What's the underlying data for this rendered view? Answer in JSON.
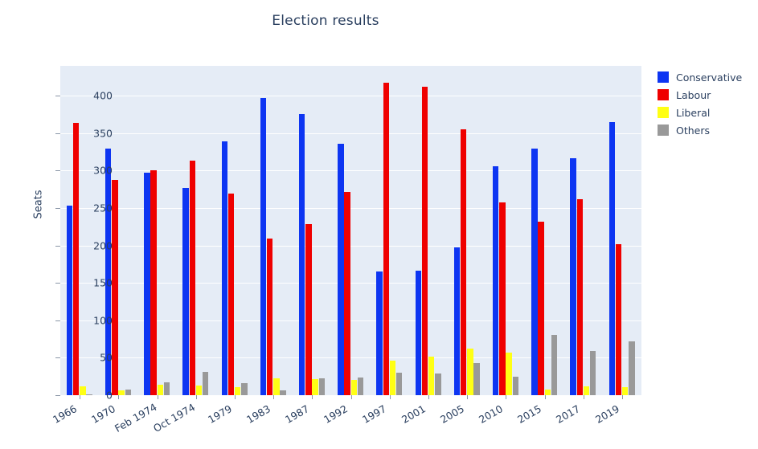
{
  "chart_data": {
    "type": "bar",
    "title": "Election results",
    "xlabel": "",
    "ylabel": "Seats",
    "ylim": [
      0,
      440
    ],
    "yticks": [
      0,
      50,
      100,
      150,
      200,
      250,
      300,
      350,
      400
    ],
    "grid": true,
    "legend_position": "right",
    "categories": [
      "1966",
      "1970",
      "Feb 1974",
      "Oct 1974",
      "1979",
      "1983",
      "1987",
      "1992",
      "1997",
      "2001",
      "2005",
      "2010",
      "2015",
      "2017",
      "2019"
    ],
    "series": [
      {
        "name": "Conservative",
        "color": "#0d35f2",
        "values": [
          253,
          330,
          297,
          277,
          339,
          397,
          376,
          336,
          165,
          166,
          198,
          306,
          330,
          317,
          365
        ]
      },
      {
        "name": "Labour",
        "color": "#ef0000",
        "values": [
          364,
          288,
          301,
          313,
          269,
          209,
          229,
          271,
          418,
          412,
          355,
          258,
          232,
          262,
          202
        ]
      },
      {
        "name": "Liberal",
        "color": "#ffff14",
        "values": [
          12,
          6,
          14,
          13,
          11,
          23,
          22,
          20,
          46,
          52,
          62,
          57,
          8,
          12,
          11
        ]
      },
      {
        "name": "Others",
        "color": "#999999",
        "values": [
          1,
          7,
          17,
          31,
          16,
          6,
          23,
          24,
          30,
          29,
          43,
          25,
          80,
          59,
          72
        ]
      }
    ]
  },
  "legend": {
    "entries": [
      {
        "label": "Conservative",
        "color": "#0d35f2"
      },
      {
        "label": "Labour",
        "color": "#ef0000"
      },
      {
        "label": "Liberal",
        "color": "#ffff14"
      },
      {
        "label": "Others",
        "color": "#999999"
      }
    ]
  },
  "colors": {
    "plot_background": "#e5ecf6",
    "page_background": "#ffffff",
    "text": "#2a3f5f",
    "gridline": "#ffffff"
  }
}
